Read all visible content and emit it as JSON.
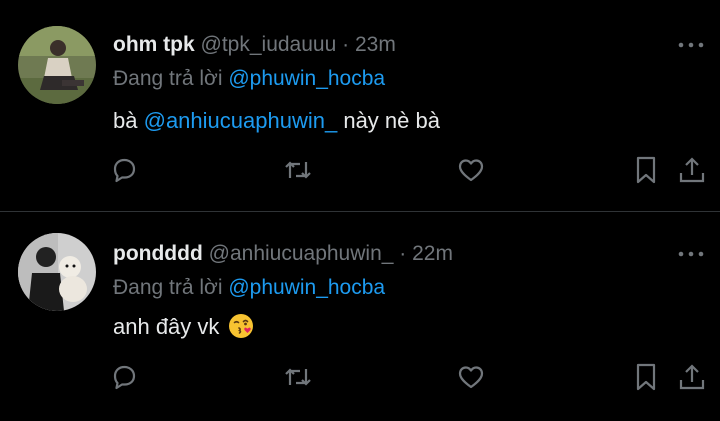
{
  "colors": {
    "background": "#000000",
    "text": "#e7e9ea",
    "muted": "#71767b",
    "link": "#1d9bf0",
    "divider": "#2f3336"
  },
  "tweets": [
    {
      "display_name": "ohm tpk",
      "handle": "@tpk_iudauuu",
      "separator": "·",
      "time": "23m",
      "replying_prefix": "Đang trả lời",
      "replying_to": "@phuwin_hocba",
      "text_before": "bà",
      "mention": "@anhiucuaphuwin_",
      "text_after": "này nè bà",
      "avatar_icon": "avatar-photo-person-sitting"
    },
    {
      "display_name": "pondddd",
      "handle": "@anhiucuaphuwin_",
      "separator": "·",
      "time": "22m",
      "replying_prefix": "Đang trả lời",
      "replying_to": "@phuwin_hocba",
      "text": "anh đây vk",
      "emoji": "face-blowing-a-kiss",
      "avatar_icon": "avatar-photo-person-with-dog"
    }
  ],
  "icons": {
    "more": "more-dots-icon",
    "reply": "reply-icon",
    "retweet": "retweet-icon",
    "like": "like-icon",
    "bookmark": "bookmark-icon",
    "share": "share-icon"
  }
}
